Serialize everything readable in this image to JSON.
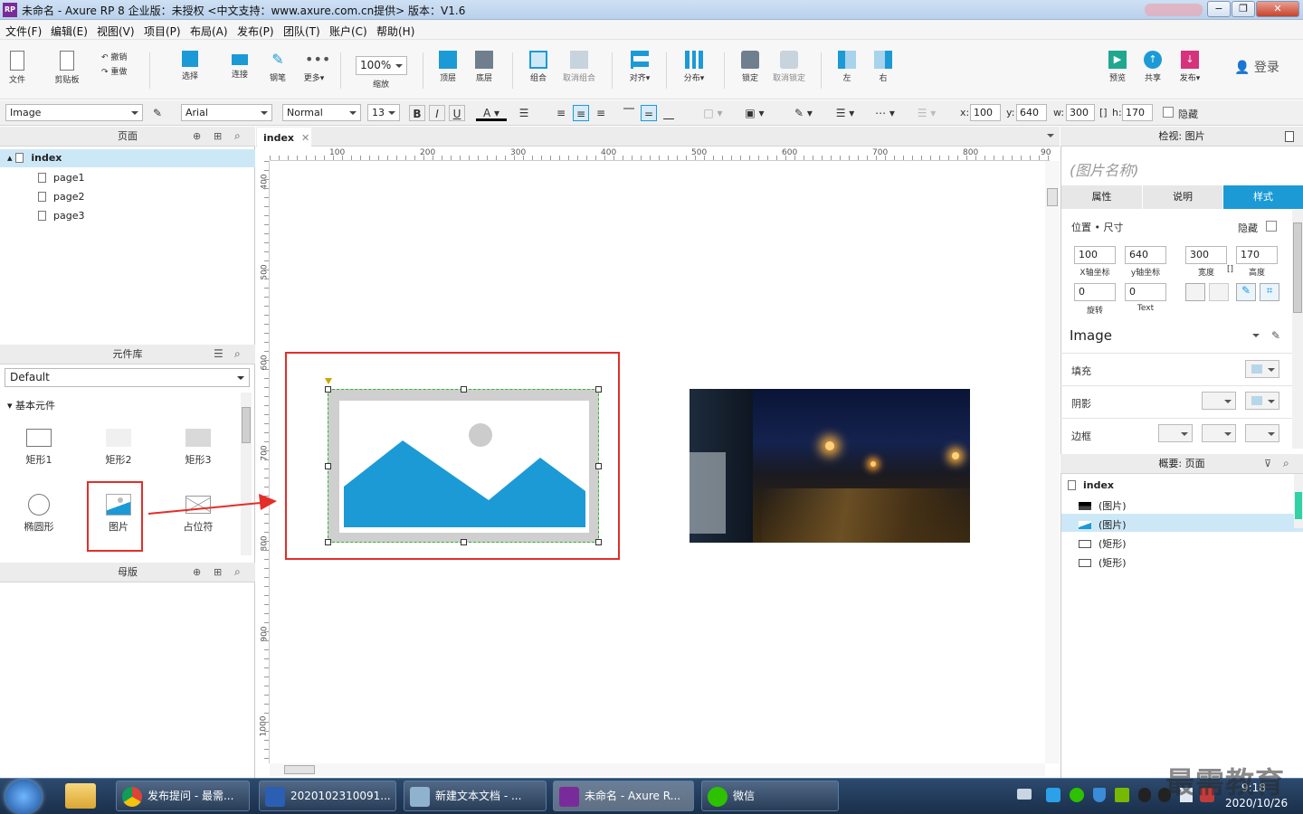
{
  "window": {
    "title": "未命名 - Axure RP 8 企业版：未授权     <中文支持：www.axure.com.cn提供> 版本：V1.6",
    "app_icon": "RP"
  },
  "menu": [
    "文件(F)",
    "编辑(E)",
    "视图(V)",
    "项目(P)",
    "布局(A)",
    "发布(P)",
    "团队(T)",
    "账户(C)",
    "帮助(H)"
  ],
  "toolbar": {
    "file": "文件",
    "clipboard": "剪贴板",
    "undo": "撤销",
    "redo": "重做",
    "select": "选择",
    "connect": "连接",
    "pen": "钢笔",
    "more": "更多▾",
    "zoom_value": "100%",
    "zoom_label": "缩放",
    "top": "顶层",
    "bottom": "底层",
    "group": "组合",
    "ungroup": "取消组合",
    "align": "对齐▾",
    "distribute": "分布▾",
    "lock": "锁定",
    "unlock": "取消锁定",
    "left": "左",
    "right": "右",
    "preview": "预览",
    "share": "共享",
    "publish": "发布▾",
    "login": "登录"
  },
  "format": {
    "style": "Image",
    "font": "Arial",
    "weight": "Normal",
    "size": "13",
    "x_label": "x:",
    "x": "100",
    "y_label": "y:",
    "y": "640",
    "w_label": "w:",
    "w": "300",
    "h_label": "h:",
    "h": "170",
    "hidden": "隐藏"
  },
  "pages_panel": {
    "title": "页面",
    "root": "index",
    "children": [
      "page1",
      "page2",
      "page3"
    ]
  },
  "library_panel": {
    "title": "元件库",
    "selected": "Default",
    "group": "基本元件",
    "widgets": [
      "矩形1",
      "矩形2",
      "矩形3",
      "椭圆形",
      "图片",
      "占位符"
    ]
  },
  "master_panel": {
    "title": "母版"
  },
  "canvas": {
    "tab": "index",
    "ruler_h": [
      "100",
      "200",
      "300",
      "400",
      "500",
      "600",
      "700",
      "800",
      "90"
    ],
    "ruler_v": [
      "400",
      "500",
      "600",
      "700",
      "800",
      "900",
      "1000"
    ]
  },
  "inspector": {
    "title": "检视: 图片",
    "name_placeholder": "(图片名称)",
    "tabs": [
      "属性",
      "说明",
      "样式"
    ],
    "section": "位置 • 尺寸",
    "hidden": "隐藏",
    "x": "100",
    "x_label": "X轴坐标",
    "y": "640",
    "y_label": "y轴坐标",
    "w": "300",
    "w_label": "宽度",
    "h": "170",
    "h_label": "高度",
    "rotate": "0",
    "rotate_label": "旋转",
    "text_rotate": "0",
    "text_label": "Text",
    "style_name": "Image",
    "fill": "填充",
    "shadow": "阴影",
    "border": "边框"
  },
  "outline": {
    "title": "概要: 页面",
    "root": "index",
    "items": [
      "(图片)",
      "(图片)",
      "(矩形)",
      "(矩形)"
    ]
  },
  "taskbar": {
    "items": [
      "发布提问 - 最需...",
      "2020102310091...",
      "新建文本文档 - ...",
      "未命名 - Axure R...",
      "微信"
    ],
    "time": "9:18",
    "date": "2020/10/26",
    "watermark": "最需教育"
  },
  "colors": {
    "accent": "#1c9ad6",
    "highlight": "#e52d27",
    "selection_row": "#cce8f7"
  }
}
